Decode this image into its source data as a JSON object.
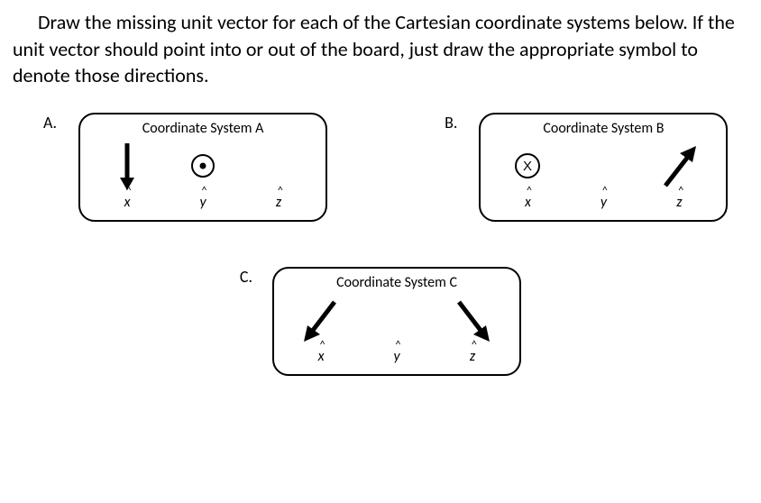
{
  "question": "Draw the missing unit vector for each of the Cartesian coordinate systems below.  If the unit vector should point into or out of the board, just draw the appropriate symbol to denote those directions.",
  "parts": {
    "a": {
      "label": "A.",
      "title": "Coordinate System A",
      "axes": {
        "x": "x",
        "y": "y",
        "z": "z"
      }
    },
    "b": {
      "label": "B.",
      "title": "Coordinate System B",
      "axes": {
        "x": "x",
        "y": "y",
        "z": "z"
      },
      "x_marker": "X"
    },
    "c": {
      "label": "C.",
      "title": "Coordinate System C",
      "axes": {
        "x": "x",
        "y": "y",
        "z": "z"
      }
    }
  },
  "chart_data": [
    {
      "type": "table",
      "title": "Coordinate System A",
      "vectors": {
        "x_hat": "arrow pointing down",
        "y_hat": "out of page (dot in circle)",
        "z_hat": "missing (to be drawn)"
      }
    },
    {
      "type": "table",
      "title": "Coordinate System B",
      "vectors": {
        "x_hat": "into page (X in circle)",
        "y_hat": "missing (to be drawn)",
        "z_hat": "arrow pointing up-right"
      }
    },
    {
      "type": "table",
      "title": "Coordinate System C",
      "vectors": {
        "x_hat": "arrow pointing down-left",
        "y_hat": "missing (to be drawn)",
        "z_hat": "arrow pointing down-right"
      }
    }
  ]
}
